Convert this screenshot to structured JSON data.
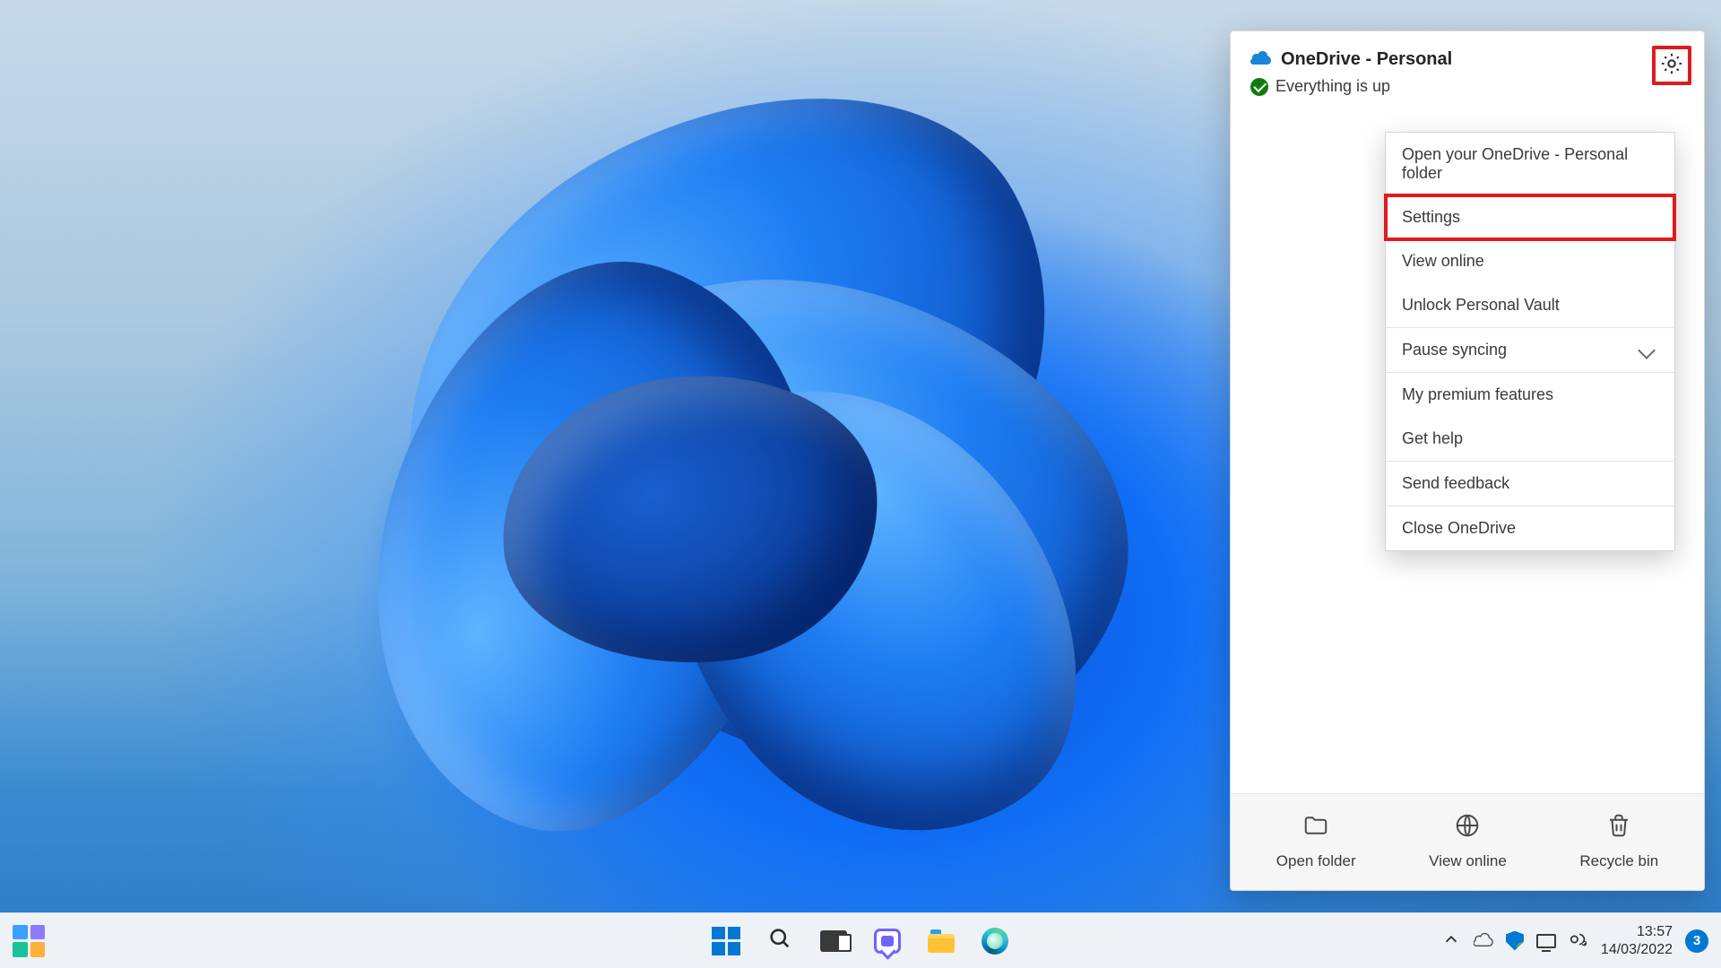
{
  "onedrive": {
    "title": "OneDrive - Personal",
    "status": "Everything is up",
    "menu": {
      "open_folder": "Open your OneDrive - Personal folder",
      "settings": "Settings",
      "view_online": "View online",
      "unlock_vault": "Unlock Personal Vault",
      "pause_syncing": "Pause syncing",
      "premium": "My premium features",
      "get_help": "Get help",
      "send_feedback": "Send feedback",
      "close": "Close OneDrive"
    },
    "footer": {
      "open_folder": "Open folder",
      "view_online": "View online",
      "recycle_bin": "Recycle bin"
    }
  },
  "taskbar": {
    "time": "13:57",
    "date": "14/03/2022",
    "notification_count": "3"
  }
}
